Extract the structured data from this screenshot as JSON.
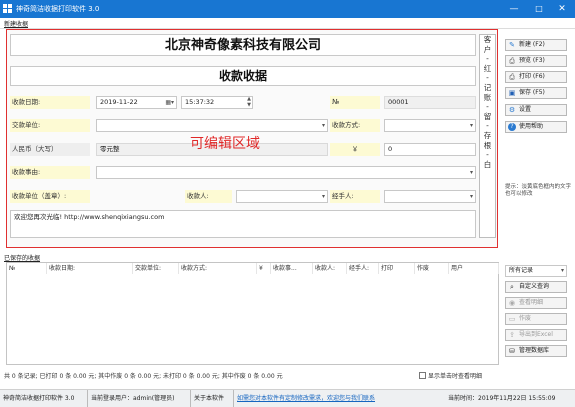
{
  "window": {
    "title": "神奇简洁收据打印软件 3.0",
    "minimize": "—",
    "maximize": "□",
    "close": "✕"
  },
  "menu": {
    "section_label": "新建收据"
  },
  "receipt": {
    "company": "北京神奇像素科技有限公司",
    "doc_title": "收款收据",
    "date_label": "收款日期:",
    "date_value": "2019-11-22",
    "time_value": "15:37:32",
    "no_label": "№",
    "no_value": "00001",
    "payer_label": "交款单位:",
    "method_label": "收款方式:",
    "rmb_label": "人民币（大写）",
    "rmb_value": "零元整",
    "yen_symbol": "￥",
    "amount_value": "0",
    "reason_label": "收款事由:",
    "unit_label": "收款单位（盖章）:",
    "receiver_label": "收款人:",
    "handler_label": "经手人:",
    "note_text": "欢迎您再次光临! http://www.shenqixiangsu.com",
    "overlay_text": "可编辑区域",
    "stub_chars": [
      "客",
      "户",
      "-",
      "红",
      "-",
      "记",
      "账",
      "-",
      "留",
      "-",
      "存",
      "根",
      "-",
      "白"
    ]
  },
  "actions": {
    "buttons": [
      {
        "label": "新建 (F2)",
        "icon": "✎",
        "icon_name": "new-doc-icon"
      },
      {
        "label": "预览 (F3)",
        "icon": "⎙",
        "icon_name": "preview-icon"
      },
      {
        "label": "打印 (F6)",
        "icon": "⎙",
        "icon_name": "printer-icon"
      },
      {
        "label": "保存 (F5)",
        "icon": "▣",
        "icon_name": "save-icon"
      },
      {
        "label": "设置",
        "icon": "⚙",
        "icon_name": "gear-icon"
      },
      {
        "label": "使用帮助",
        "icon": "?",
        "icon_name": "help-icon"
      }
    ],
    "tip": "提示：淡黄底色框内的文字也可以修改"
  },
  "records": {
    "section_label": "已保存的收据",
    "columns": [
      "№",
      "收款日期:",
      "交款单位:",
      "收款方式:",
      "¥",
      "收款事...",
      "收款人:",
      "经手人:",
      "打印",
      "作废",
      "用户"
    ],
    "filter_value": "所有记录",
    "side_buttons": [
      "自定义查询",
      "查看明细",
      "作废",
      "导出到Excel",
      "管理数据库"
    ]
  },
  "summary": {
    "text": "共 0 条记录; 已打印 0 条 0.00 元; 其中作废 0 条 0.00 元; 未打印 0 条 0.00 元; 其中作废 0 条 0.00 元",
    "checkbox_label": "显示单击时查看明细"
  },
  "status": {
    "app": "神奇简洁收据打印软件 3.0",
    "user": "当前登录用户：admin(管理员)",
    "about": "关于本软件",
    "notice": "如需您对本软件有定制修改需求，欢迎您与我们联系",
    "time": "当前时间：2019年11月22日 15:55:09"
  },
  "colors": {
    "titlebar": "#1876d2",
    "panel_border": "#e03030",
    "label_bg": "#fdfad3",
    "overlay": "#e02828",
    "notice": "#1565c0"
  }
}
